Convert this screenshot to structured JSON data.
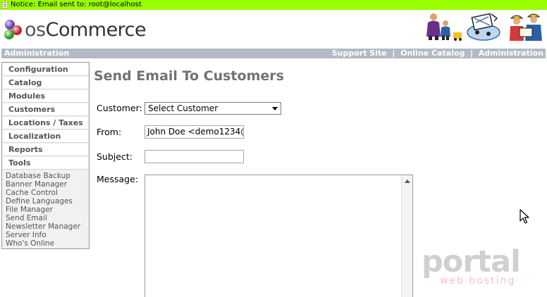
{
  "notice": {
    "text": "Notice: Email sent to: root@localhost",
    "bg": "#99ff00"
  },
  "header": {
    "logo_prefix": "os",
    "logo_name": "Commerce"
  },
  "navbar": {
    "left_label": "Administration",
    "links": [
      "Support Site",
      "Online Catalog",
      "Administration"
    ],
    "separator": "|",
    "bg": "#b3bac5"
  },
  "sidebar": {
    "items": [
      "Configuration",
      "Catalog",
      "Modules",
      "Customers",
      "Locations / Taxes",
      "Localization",
      "Reports",
      "Tools"
    ],
    "tools_sub": [
      "Database Backup",
      "Banner Manager",
      "Cache Control",
      "Define Languages",
      "File Manager",
      "Send Email",
      "Newsletter Manager",
      "Server Info",
      "Who's Online"
    ]
  },
  "main": {
    "title": "Send Email To Customers",
    "customer_label": "Customer:",
    "customer_value": "Select Customer",
    "from_label": "From:",
    "from_value": "John Doe <demo1234@",
    "subject_label": "Subject:",
    "subject_value": "",
    "message_label": "Message:"
  },
  "watermark": {
    "big": "portal",
    "small": "web hosting"
  }
}
